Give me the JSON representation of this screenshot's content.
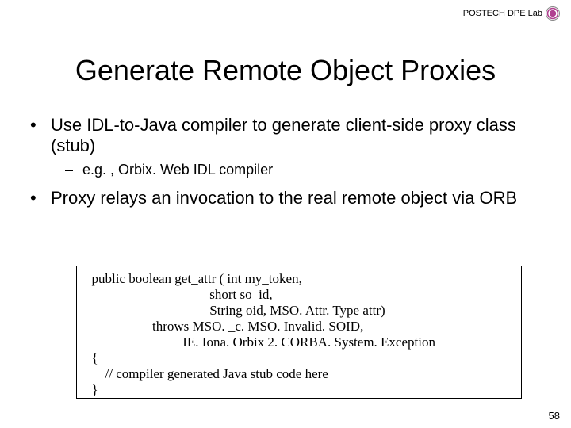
{
  "header": {
    "lab": "POSTECH DPE Lab"
  },
  "title": "Generate Remote Object Proxies",
  "bullets": [
    {
      "text": "Use IDL-to-Java compiler to generate client-side proxy class (stub)",
      "sub": "e.g. , Orbix. Web IDL compiler"
    },
    {
      "text": "Proxy relays an invocation to the real remote object via ORB"
    }
  ],
  "code": {
    "l1": "  public boolean get_attr ( int my_token,",
    "l2": "                                     short so_id,",
    "l3": "                                     String oid, MSO. Attr. Type attr)",
    "l4": "                    throws MSO. _c. MSO. Invalid. SOID,",
    "l5": "                             IE. Iona. Orbix 2. CORBA. System. Exception",
    "l6": "  {",
    "l7": "      // compiler generated Java stub code here",
    "l8": "  }"
  },
  "page_number": "58"
}
